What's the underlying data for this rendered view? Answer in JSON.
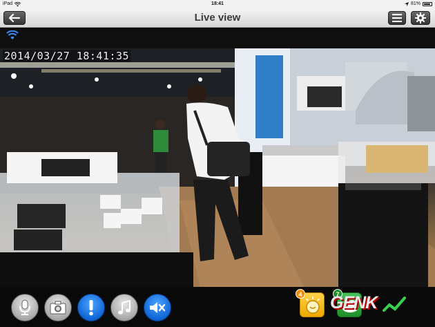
{
  "status_bar": {
    "device": "iPad",
    "time": "18:41",
    "battery": "81%"
  },
  "nav": {
    "title": "Live view"
  },
  "video": {
    "timestamp": "2014/03/27  18:41:35"
  },
  "badges": {
    "first_count": "4",
    "second_count": "7"
  },
  "watermark": "GENK",
  "colors": {
    "nav_text": "#3a3a3a",
    "accent_blue": "#1066d6",
    "badge_orange": "#f08a00",
    "badge_green": "#1f8f2a"
  }
}
